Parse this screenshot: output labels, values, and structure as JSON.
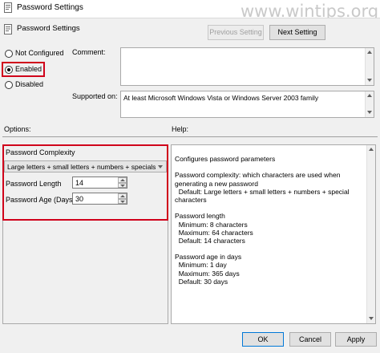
{
  "window": {
    "title": "Password Settings"
  },
  "watermark": "www.wintips.org",
  "header": {
    "title": "Password Settings"
  },
  "buttons": {
    "previous": "Previous Setting",
    "next": "Next Setting",
    "ok": "OK",
    "cancel": "Cancel",
    "apply": "Apply"
  },
  "state": {
    "options": [
      {
        "label": "Not Configured",
        "checked": false
      },
      {
        "label": "Enabled",
        "checked": true
      },
      {
        "label": "Disabled",
        "checked": false
      }
    ]
  },
  "comment": {
    "label": "Comment:",
    "value": ""
  },
  "supported": {
    "label": "Supported on:",
    "value": "At least Microsoft Windows Vista or Windows Server 2003 family"
  },
  "options_section": {
    "label": "Options:",
    "complexity_label": "Password Complexity",
    "complexity_value": "Large letters + small letters + numbers + specials",
    "length_label": "Password Length",
    "length_value": "14",
    "age_label": "Password Age (Days)",
    "age_value": "30"
  },
  "help": {
    "label": "Help:",
    "lines": [
      "Configures password parameters",
      "",
      "Password complexity: which characters are used when",
      "generating a new password",
      "  Default: Large letters + small letters + numbers + special",
      "characters",
      "",
      "Password length",
      "  Minimum: 8 characters",
      "  Maximum: 64 characters",
      "  Default: 14 characters",
      "",
      "Password age in days",
      "  Minimum: 1 day",
      "  Maximum: 365 days",
      "  Default: 30 days"
    ]
  },
  "colors": {
    "highlight": "#d0021b",
    "dialog_bg": "#f0f0f0"
  }
}
